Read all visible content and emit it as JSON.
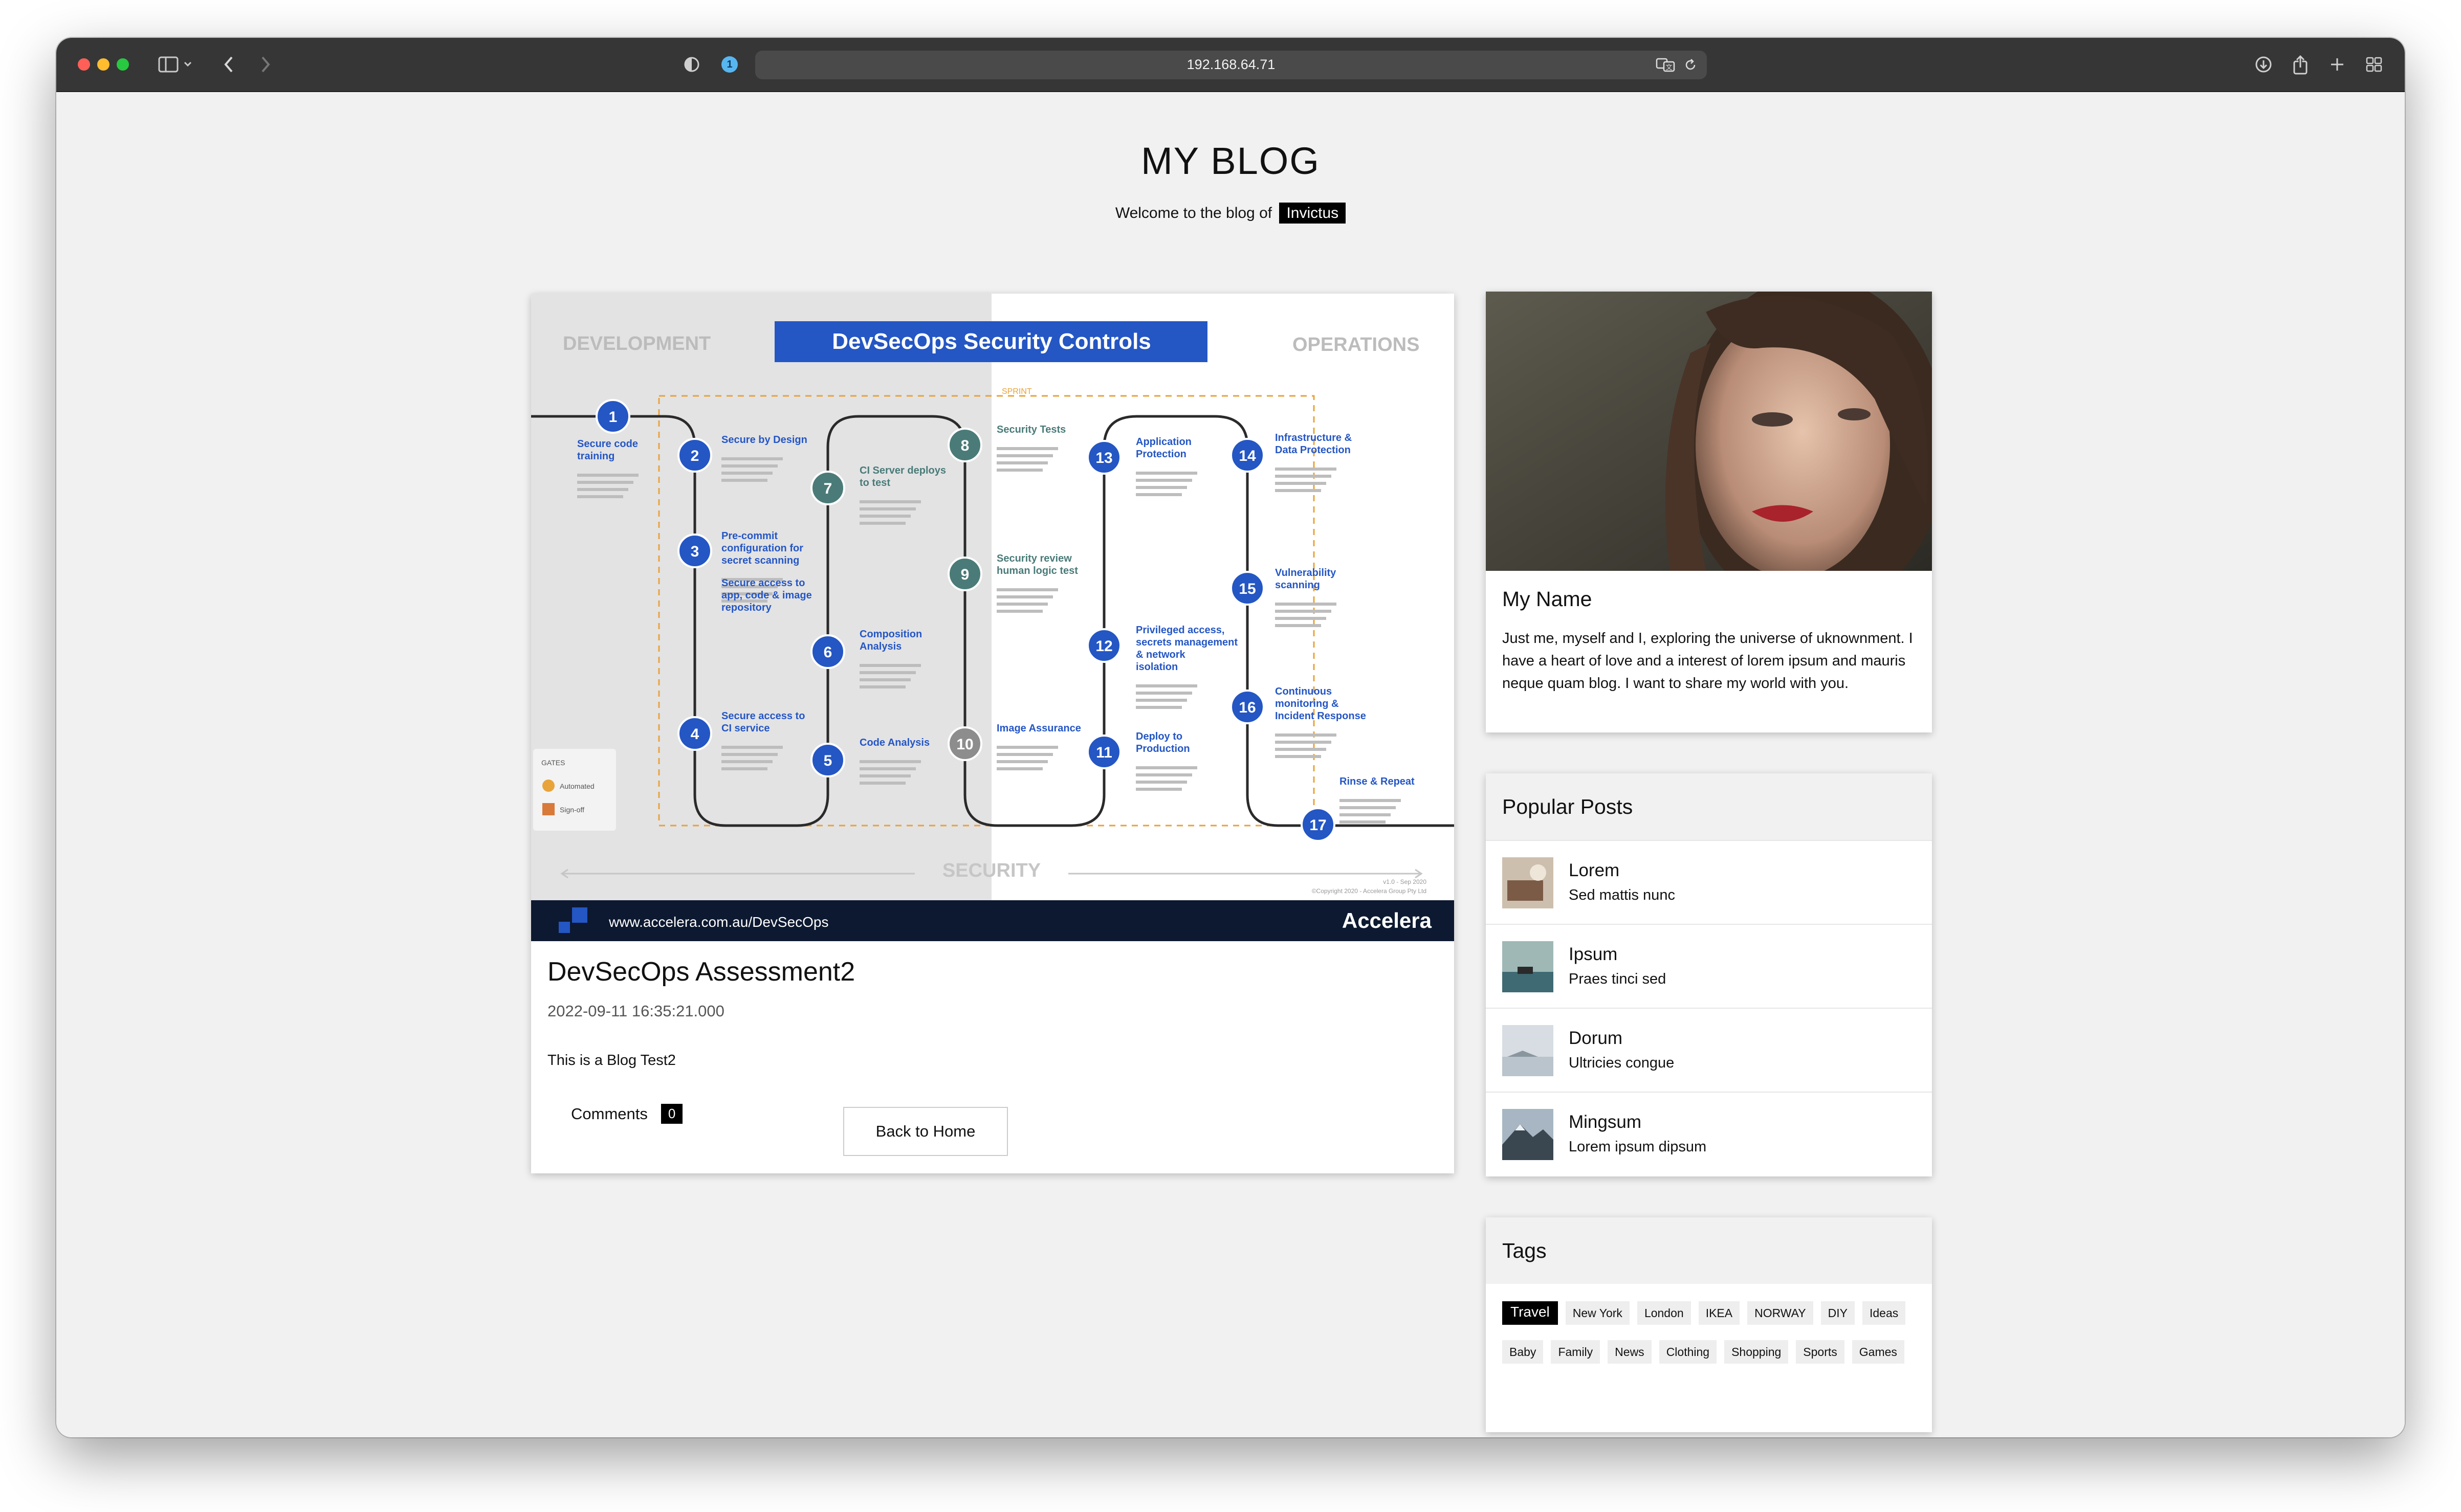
{
  "browser": {
    "url": "192.168.64.71",
    "extension_badge": "1"
  },
  "blog": {
    "title": "MY BLOG",
    "welcome": "Welcome to the blog of",
    "owner": "Invictus"
  },
  "post": {
    "title": "DevSecOps Assessment2",
    "date": "2022-09-11 16:35:21.000",
    "body": "This is a Blog Test2",
    "comments_label": "Comments",
    "comments_count": "0",
    "back_label": "Back to Home",
    "image": {
      "heading": "DevSecOps Security Controls",
      "development": "DEVELOPMENT",
      "operations": "OPERATIONS",
      "security": "SECURITY",
      "website": "www.accelera.com.au/DevSecOps",
      "brand": "Accelera",
      "version": "v1.0 - Sep 2020",
      "copyright": "©Copyright 2020 - Accelera Group Pty Ltd",
      "sprint_label": "SPRINT",
      "gates_title": "GATES",
      "gate_automated": "Automated",
      "gate_signoff": "Sign-off",
      "steps": [
        {
          "n": "1",
          "label": "Secure code training"
        },
        {
          "n": "2",
          "label": "Secure by Design"
        },
        {
          "n": "3",
          "label": "Pre-commit configuration for secret scanning"
        },
        {
          "n": "4",
          "label": "Secure access to CI service"
        },
        {
          "n": "5",
          "label": "Code Analysis"
        },
        {
          "n": "6",
          "label": "Composition Analysis"
        },
        {
          "n": "7",
          "label": "CI Server deploys to test"
        },
        {
          "n": "8",
          "label": "Security Tests"
        },
        {
          "n": "9",
          "label": "Security review human logic test"
        },
        {
          "n": "10",
          "label": "Image Assurance"
        },
        {
          "n": "11",
          "label": "Deploy to Production"
        },
        {
          "n": "12",
          "label": "Privileged access, secrets management & network isolation"
        },
        {
          "n": "13",
          "label": "Application Protection"
        },
        {
          "n": "14",
          "label": "Infrastructure & Data Protection"
        },
        {
          "n": "15",
          "label": "Vulnerability scanning"
        },
        {
          "n": "16",
          "label": "Continuous monitoring & Incident Response"
        },
        {
          "n": "17",
          "label": "Rinse & Repeat"
        }
      ],
      "extra_labels": {
        "secure_access_repo": "Secure access to app, code & image repository"
      }
    }
  },
  "profile": {
    "name": "My Name",
    "bio": "Just me, myself and I, exploring the universe of uknownment. I have a heart of love and a interest of lorem ipsum and mauris neque quam blog. I want to share my world with you."
  },
  "popular": {
    "title": "Popular Posts",
    "items": [
      {
        "title": "Lorem",
        "subtitle": "Sed mattis nunc"
      },
      {
        "title": "Ipsum",
        "subtitle": "Praes tinci sed"
      },
      {
        "title": "Dorum",
        "subtitle": "Ultricies congue"
      },
      {
        "title": "Mingsum",
        "subtitle": "Lorem ipsum dipsum"
      }
    ]
  },
  "tags": {
    "title": "Tags",
    "items": [
      "Travel",
      "New York",
      "London",
      "IKEA",
      "NORWAY",
      "DIY",
      "Ideas",
      "Baby",
      "Family",
      "News",
      "Clothing",
      "Shopping",
      "Sports",
      "Games"
    ],
    "active": "Travel"
  },
  "colors": {
    "accent_blue": "#2456c4",
    "teal": "#4a7b78",
    "navy": "#0d1930",
    "sprint_orange": "#e8a33b",
    "toolbar": "#363637"
  }
}
